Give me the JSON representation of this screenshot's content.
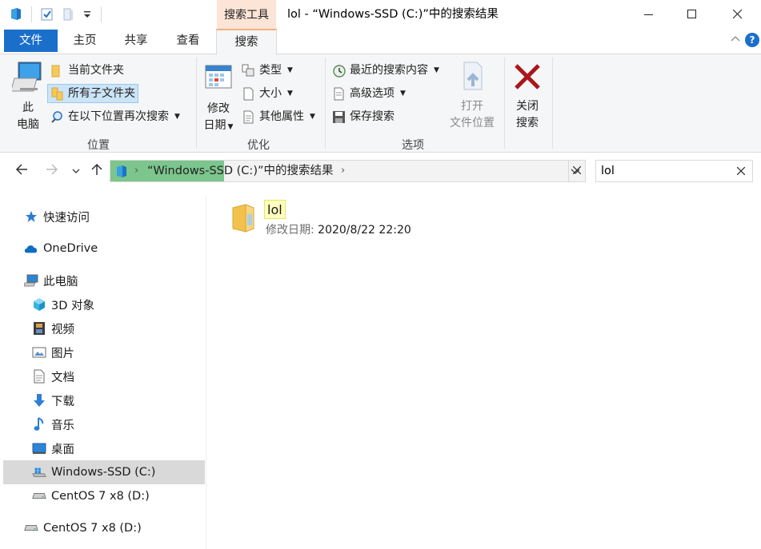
{
  "window": {
    "title": "lol - “Windows-SSD (C:)”中的搜索结果",
    "context_tab_header": "搜索工具"
  },
  "tabs": [
    {
      "label": "文件"
    },
    {
      "label": "主页"
    },
    {
      "label": "共享"
    },
    {
      "label": "查看"
    },
    {
      "label": "搜索"
    }
  ],
  "ribbon": {
    "location": {
      "group_label": "位置",
      "this_pc_line1": "此",
      "this_pc_line2": "电脑",
      "current_folder": "当前文件夹",
      "all_subfolders": "所有子文件夹",
      "search_again_in": "在以下位置再次搜索"
    },
    "refine": {
      "group_label": "优化",
      "date_modified_line1": "修改",
      "date_modified_line2": "日期",
      "kind": "类型",
      "size": "大小",
      "other_properties": "其他属性"
    },
    "options": {
      "group_label": "选项",
      "recent_searches": "最近的搜索内容",
      "advanced_options": "高级选项",
      "save_search": "保存搜索",
      "open_location_line1": "打开",
      "open_location_line2": "文件位置"
    },
    "close": {
      "label_line1": "关闭",
      "label_line2": "搜索"
    }
  },
  "address": {
    "path": "“Windows-SSD (C:)”中的搜索结果",
    "search_progress": 0.24
  },
  "search": {
    "value": "lol"
  },
  "nav_pane": {
    "items": [
      {
        "label": "快速访问",
        "icon": "star-icon"
      },
      {
        "label": "OneDrive",
        "icon": "cloud-icon"
      },
      {
        "label": "此电脑",
        "icon": "computer-icon"
      },
      {
        "label": "3D 对象",
        "icon": "cube-icon"
      },
      {
        "label": "视频",
        "icon": "film-icon"
      },
      {
        "label": "图片",
        "icon": "picture-icon"
      },
      {
        "label": "文档",
        "icon": "document-icon"
      },
      {
        "label": "下载",
        "icon": "download-arrow-icon"
      },
      {
        "label": "音乐",
        "icon": "music-note-icon"
      },
      {
        "label": "桌面",
        "icon": "desktop-icon"
      },
      {
        "label": "Windows-SSD (C:)",
        "icon": "windows-drive-icon"
      },
      {
        "label": "CentOS 7 x8 (D:)",
        "icon": "drive-icon"
      },
      {
        "label": "CentOS 7 x8 (D:)",
        "icon": "drive-icon"
      }
    ]
  },
  "results": [
    {
      "name": "lol",
      "meta_key": "修改日期:",
      "meta_value": "2020/8/22 22:20",
      "icon": "folder-icon"
    }
  ],
  "colors": {
    "file_tab": "#1a6fca",
    "context_tab": "#fce4d6",
    "progress": "#7cc58d",
    "selected_nav": "#d9d9d9",
    "highlight": "#ffffbf"
  }
}
